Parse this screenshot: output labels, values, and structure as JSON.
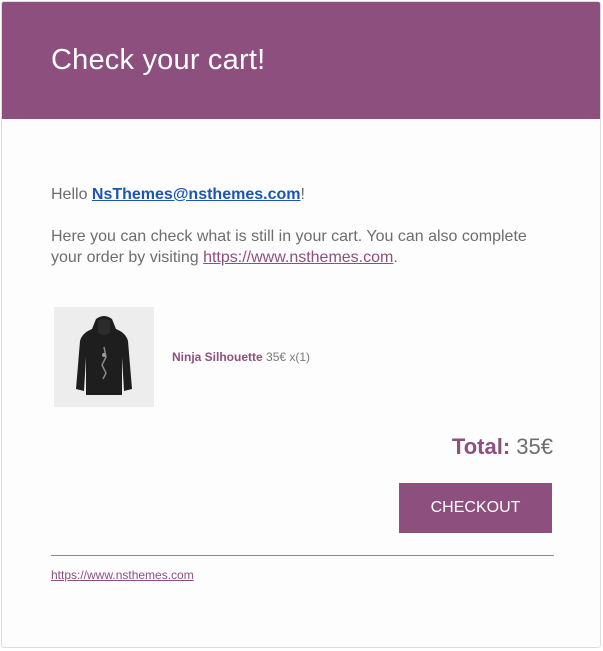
{
  "header": {
    "title": "Check your cart!"
  },
  "greeting": {
    "prefix": "Hello ",
    "email": "NsThemes@nsthemes.com",
    "suffix": "!"
  },
  "intro": {
    "text": "Here you can check what is still in your cart. You can also complete your order by visiting ",
    "link": "https://www.nsthemes.com",
    "end": "."
  },
  "product": {
    "name": "Ninja Silhouette",
    "price_qty": "35€ x(1)",
    "image_icon": "hoodie-icon"
  },
  "total": {
    "label": "Total:",
    "amount": "35€"
  },
  "checkout_label": "CHECKOUT",
  "footer": {
    "link": "https://www.nsthemes.com"
  },
  "colors": {
    "accent": "#8c4f7e",
    "link_blue": "#1a56b4",
    "text": "#6d6d6d"
  }
}
